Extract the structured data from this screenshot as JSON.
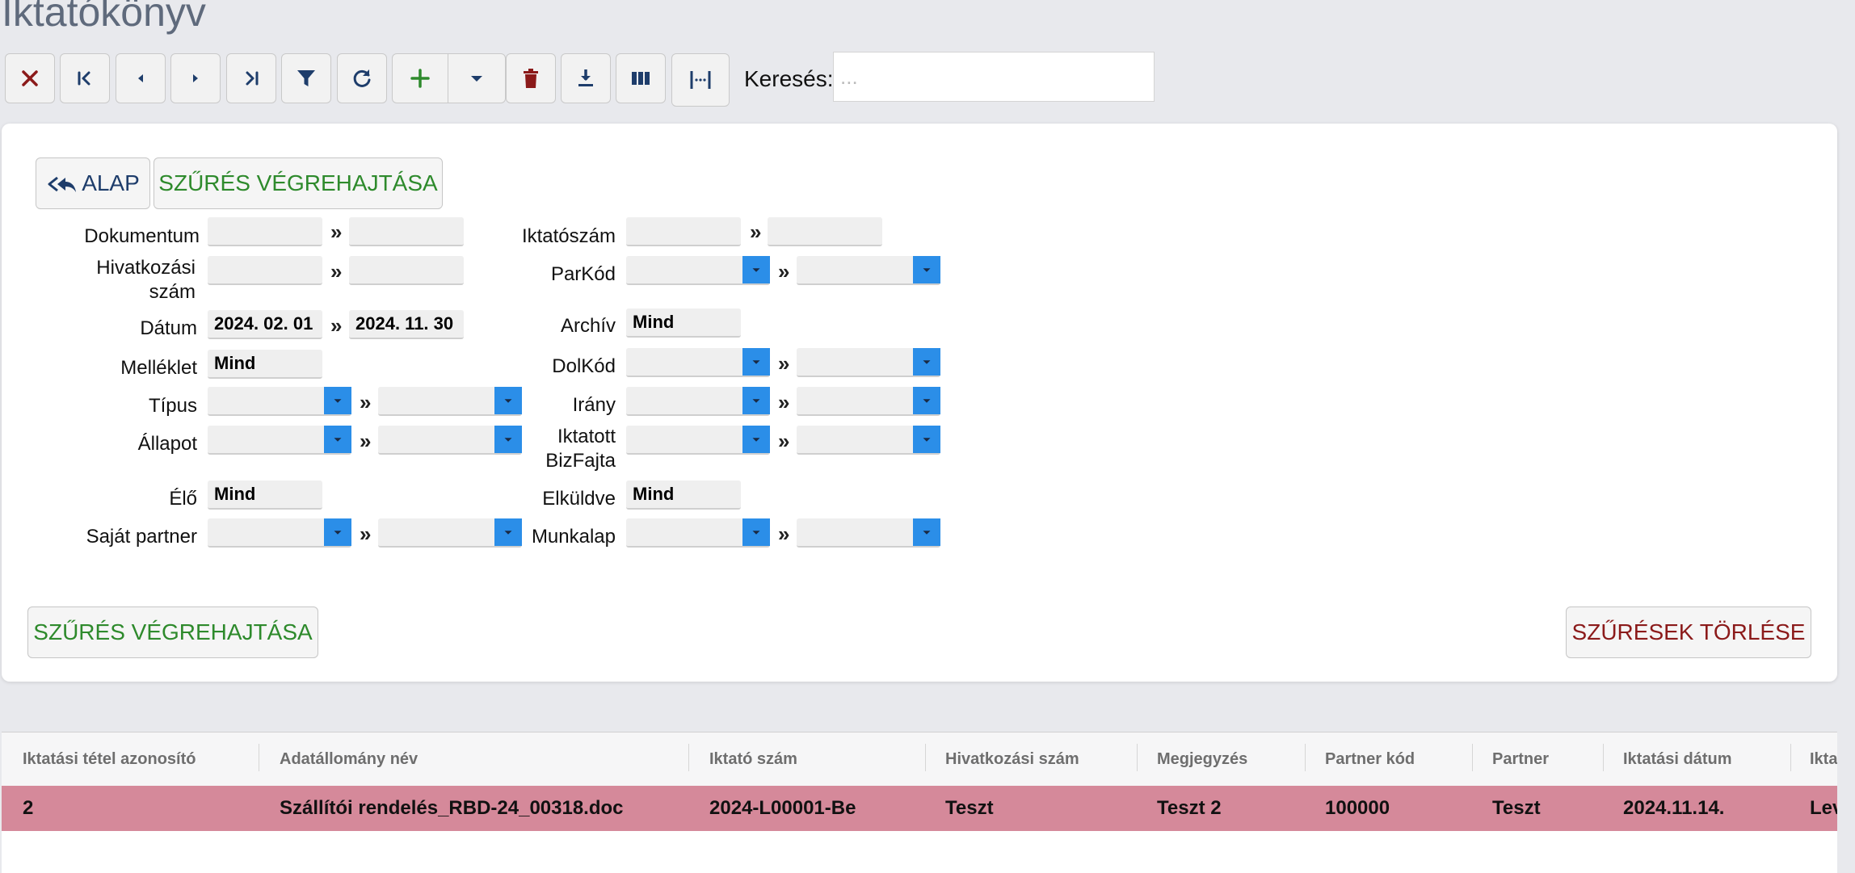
{
  "page": {
    "title": "Iktatókönyv"
  },
  "toolbar": {
    "buttons": [
      {
        "name": "close-button",
        "icon": "close-icon",
        "color": "#8b1a1a"
      },
      {
        "name": "first-record-button",
        "icon": "first-page-icon",
        "color": "#1e3d6b"
      },
      {
        "name": "previous-record-button",
        "icon": "chevron-left-icon",
        "color": "#1e3d6b"
      },
      {
        "name": "next-record-button",
        "icon": "chevron-right-icon",
        "color": "#1e3d6b"
      },
      {
        "name": "last-record-button",
        "icon": "last-page-icon",
        "color": "#1e3d6b"
      },
      {
        "name": "filter-button",
        "icon": "funnel-icon",
        "color": "#1e3d6b"
      },
      {
        "name": "refresh-button",
        "icon": "refresh-icon",
        "color": "#1e3d6b"
      },
      {
        "name": "add-button",
        "icon": "plus-icon",
        "color": "#2e8a2c"
      },
      {
        "name": "add-dropdown-button",
        "icon": "caret-down-icon",
        "color": "#1e3d6b"
      },
      {
        "name": "delete-button",
        "icon": "trash-icon",
        "color": "#8b1a1a"
      },
      {
        "name": "download-button",
        "icon": "download-icon",
        "color": "#1e3d6b"
      },
      {
        "name": "columns-button",
        "icon": "columns-icon",
        "color": "#1e3d6b"
      },
      {
        "name": "column-width-button",
        "icon": "column-width-icon",
        "color": "#1e3d6b"
      }
    ],
    "search_label": "Keresés:",
    "search_placeholder": "...",
    "search_value": ""
  },
  "filter": {
    "reset_button": "ALAP",
    "apply_button_top": "SZŰRÉS VÉGREHAJTÁSA",
    "apply_button_bottom": "SZŰRÉS VÉGREHAJTÁSA",
    "clear_button": "SZŰRÉSEK TÖRLÉSE",
    "range_separator": "»",
    "left": {
      "dokumentum": {
        "label": "Dokumentum",
        "from": "",
        "to": ""
      },
      "hivatkozasi_szam": {
        "label_line1": "Hivatkozási",
        "label_line2": "szám",
        "from": "",
        "to": ""
      },
      "datum": {
        "label": "Dátum",
        "from": "2024. 02. 01",
        "to": "2024. 11. 30"
      },
      "melleklet": {
        "label": "Melléklet",
        "value": "Mind"
      },
      "tipus": {
        "label": "Típus",
        "from": "",
        "to": ""
      },
      "allapot": {
        "label": "Állapot",
        "from": "",
        "to": ""
      },
      "elo": {
        "label": "Élő",
        "value": "Mind"
      },
      "sajat_partner": {
        "label": "Saját partner",
        "from": "",
        "to": ""
      }
    },
    "right": {
      "iktatoszam": {
        "label": "Iktatószám",
        "from": "",
        "to": ""
      },
      "parkod": {
        "label": "ParKód",
        "from": "",
        "to": ""
      },
      "archiv": {
        "label": "Archív",
        "value": "Mind"
      },
      "dolkod": {
        "label": "DolKód",
        "from": "",
        "to": ""
      },
      "irany": {
        "label": "Irány",
        "from": "",
        "to": ""
      },
      "iktatott_bizfajta": {
        "label_line1": "Iktatott",
        "label_line2": "BizFajta",
        "from": "",
        "to": ""
      },
      "elkuldve": {
        "label": "Elküldve",
        "value": "Mind"
      },
      "munkalap": {
        "label": "Munkalap",
        "from": "",
        "to": ""
      }
    }
  },
  "grid": {
    "columns": [
      "Iktatási tétel azonosító",
      "Adatállomány név",
      "Iktató szám",
      "Hivatkozási szám",
      "Megjegyzés",
      "Partner kód",
      "Partner",
      "Iktatási dátum",
      "Ikta"
    ],
    "rows": [
      [
        "2",
        "Szállítói rendelés_RBD-24_00318.doc",
        "2024-L00001-Be",
        "Teszt",
        "Teszt 2",
        "100000",
        "Teszt",
        "2024.11.14.",
        "Lev"
      ]
    ],
    "selected_row_color": "#d5899a"
  }
}
